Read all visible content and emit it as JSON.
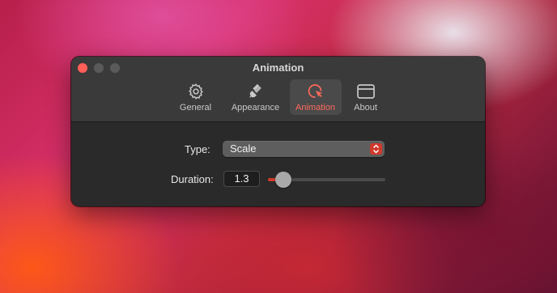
{
  "window": {
    "title": "Animation"
  },
  "toolbar": {
    "tabs": [
      {
        "label": "General",
        "icon": "gear-icon",
        "active": false
      },
      {
        "label": "Appearance",
        "icon": "paintbrush-icon",
        "active": false
      },
      {
        "label": "Animation",
        "icon": "cursor-click-icon",
        "active": true
      },
      {
        "label": "About",
        "icon": "window-icon",
        "active": false
      }
    ]
  },
  "form": {
    "type_label": "Type:",
    "type_value": "Scale",
    "duration_label": "Duration:",
    "duration_value": "1.3",
    "duration_slider_fraction": 0.13
  },
  "colors": {
    "accent": "#ff6a5c",
    "accent_dark": "#d0392b",
    "close_button": "#ff5f57"
  }
}
